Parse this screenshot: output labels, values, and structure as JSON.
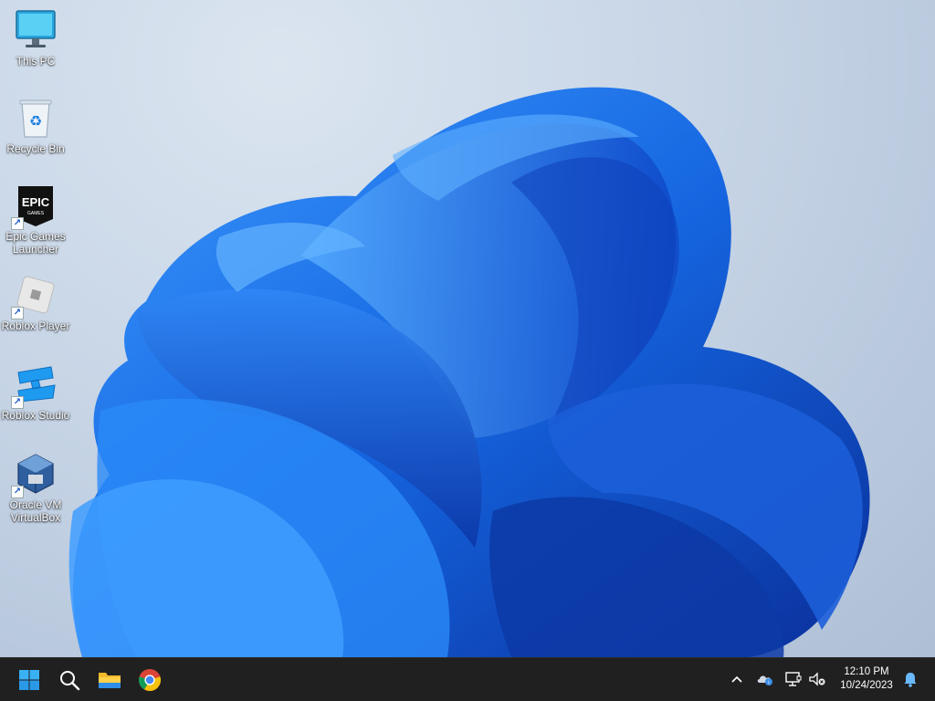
{
  "desktop": {
    "icons": [
      {
        "label": "This PC",
        "icon": "monitor-icon"
      },
      {
        "label": "Recycle Bin",
        "icon": "recycle-bin-icon"
      },
      {
        "label": "Epic Games Launcher",
        "icon": "epic-games-icon",
        "logo_text": "EPIC"
      },
      {
        "label": "Roblox Player",
        "icon": "roblox-player-icon"
      },
      {
        "label": "Roblox Studio",
        "icon": "roblox-studio-icon"
      },
      {
        "label": "Oracle VM VirtualBox",
        "icon": "virtualbox-icon"
      }
    ]
  },
  "taskbar": {
    "pinned": [
      {
        "name": "Start",
        "icon": "windows-start-icon"
      },
      {
        "name": "Search",
        "icon": "search-icon"
      },
      {
        "name": "File Explorer",
        "icon": "folder-icon"
      },
      {
        "name": "Google Chrome",
        "icon": "chrome-icon"
      }
    ],
    "tray": {
      "icons": [
        "chevron-up-icon",
        "onedrive-icon",
        "network-icon",
        "volume-muted-icon",
        "notification-bell-icon"
      ]
    },
    "clock": {
      "time": "12:10 PM",
      "date": "10/24/2023"
    }
  },
  "colors": {
    "taskbar_bg": "#202020",
    "bloom_blue": "#1f6fe6",
    "desktop_bg": "#c9d6e6"
  }
}
